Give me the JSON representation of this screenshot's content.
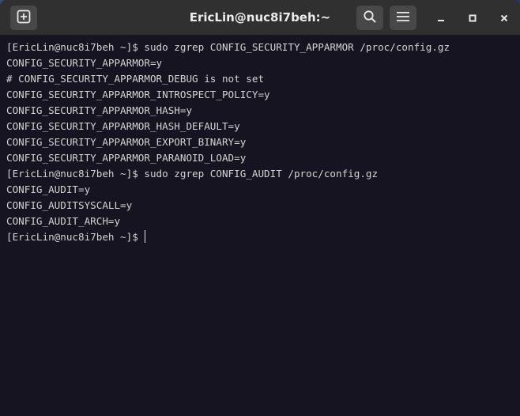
{
  "window": {
    "title": "EricLin@nuc8i7beh:~"
  },
  "headerbar": {
    "new_tab_icon": "plus-square-icon",
    "search_icon": "search-icon",
    "menu_icon": "hamburger-menu-icon",
    "minimize_icon": "minimize-icon",
    "maximize_icon": "maximize-icon",
    "close_icon": "close-icon"
  },
  "colors": {
    "terminal_bg": "#171421",
    "terminal_fg": "#d3d3d3",
    "titlebar_bg": "#303030",
    "button_bg": "#484848"
  },
  "terminal": {
    "lines": [
      "[EricLin@nuc8i7beh ~]$ sudo zgrep CONFIG_SECURITY_APPARMOR /proc/config.gz",
      "CONFIG_SECURITY_APPARMOR=y",
      "# CONFIG_SECURITY_APPARMOR_DEBUG is not set",
      "CONFIG_SECURITY_APPARMOR_INTROSPECT_POLICY=y",
      "CONFIG_SECURITY_APPARMOR_HASH=y",
      "CONFIG_SECURITY_APPARMOR_HASH_DEFAULT=y",
      "CONFIG_SECURITY_APPARMOR_EXPORT_BINARY=y",
      "CONFIG_SECURITY_APPARMOR_PARANOID_LOAD=y",
      "[EricLin@nuc8i7beh ~]$ sudo zgrep CONFIG_AUDIT /proc/config.gz",
      "CONFIG_AUDIT=y",
      "CONFIG_AUDITSYSCALL=y",
      "CONFIG_AUDIT_ARCH=y"
    ],
    "prompt": "[EricLin@nuc8i7beh ~]$"
  }
}
